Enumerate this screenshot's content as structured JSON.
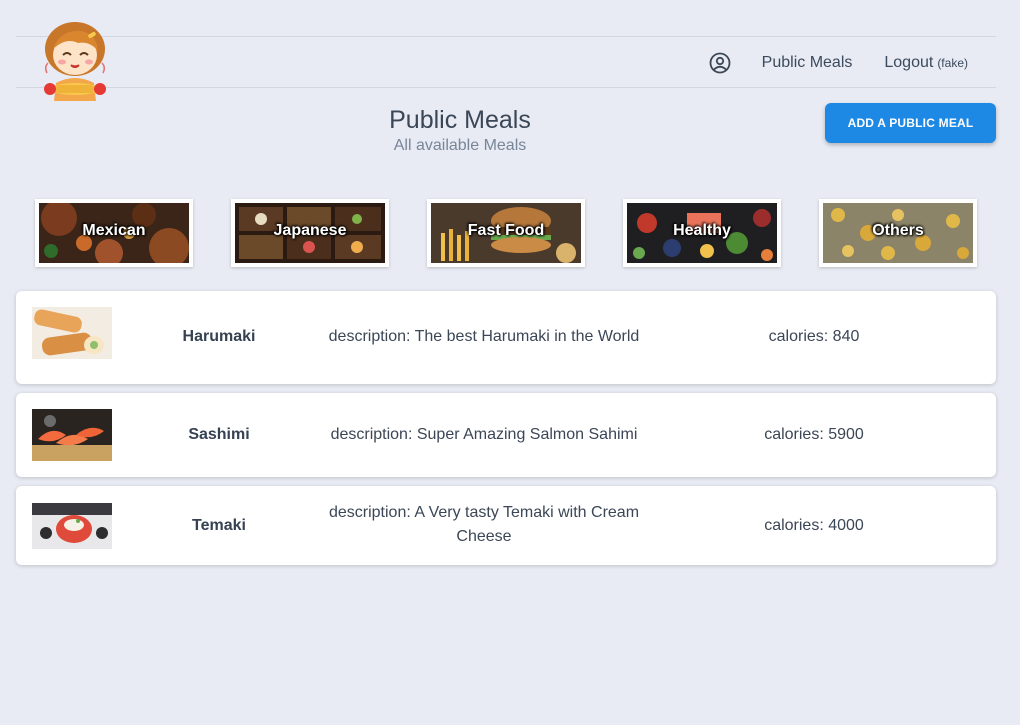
{
  "nav": {
    "public_meals": "Public Meals",
    "logout": "Logout",
    "logout_note": "(fake)"
  },
  "page": {
    "title": "Public Meals",
    "subtitle": "All available Meals",
    "add_button": "ADD A PUBLIC MEAL"
  },
  "categories": [
    {
      "label": "Mexican"
    },
    {
      "label": "Japanese"
    },
    {
      "label": "Fast Food"
    },
    {
      "label": "Healthy"
    },
    {
      "label": "Others"
    }
  ],
  "meals": [
    {
      "name": "Harumaki",
      "description": "description: The best Harumaki in the World",
      "calories": "calories: 840"
    },
    {
      "name": "Sashimi",
      "description": "description: Super Amazing Salmon Sahimi",
      "calories": "calories: 5900"
    },
    {
      "name": "Temaki",
      "description": "description: A Very tasty Temaki with Cream Cheese",
      "calories": "calories: 4000"
    }
  ],
  "colors": {
    "background": "#e8ebf3",
    "accent": "#1e88e5",
    "card": "#ffffff"
  },
  "icons": {
    "user": "user-circle-icon",
    "logo": "chef-girl-logo"
  }
}
